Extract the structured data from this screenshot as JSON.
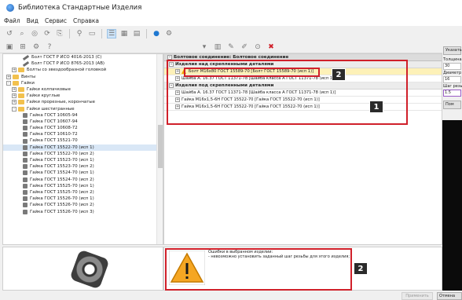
{
  "window": {
    "title": "Библиотека Стандартные Изделия"
  },
  "menu": [
    "Файл",
    "Вид",
    "Сервис",
    "Справка"
  ],
  "toolbar1_icons": [
    "reset-icon",
    "search-icon",
    "zoom-icon",
    "refresh-icon",
    "copy-icon",
    "filter-icon",
    "folder-icon",
    "view-list-icon",
    "view-grid-icon",
    "view-table-icon",
    "help-icon",
    "settings-icon"
  ],
  "toolbar2_icons": [
    "library-icon",
    "add-icon",
    "settings-icon",
    "help-icon"
  ],
  "main_toolbar_icons": [
    "save-icon",
    "table-icon",
    "settings-icon",
    "settings2-icon",
    "target-icon",
    "delete-icon"
  ],
  "tree": [
    {
      "label": "Болт ГОСТ Р ИСО 4016-2013 (С)",
      "type": "bolt",
      "indent": 3
    },
    {
      "label": "Болт ГОСТ Р ИСО 8765-2013 (АВ)",
      "type": "bolt",
      "indent": 3
    },
    {
      "label": "Болты со звездообразной головкой",
      "type": "folder",
      "indent": 1,
      "exp": "+"
    },
    {
      "label": "Винты",
      "type": "folder",
      "indent": 0,
      "exp": "+"
    },
    {
      "label": "Гайки",
      "type": "folder",
      "indent": 0,
      "exp": "-"
    },
    {
      "label": "Гайки колпачковые",
      "type": "folder",
      "indent": 1,
      "exp": "+"
    },
    {
      "label": "Гайки круглые",
      "type": "folder",
      "indent": 1,
      "exp": "+"
    },
    {
      "label": "Гайки прорезные, корончатые",
      "type": "folder",
      "indent": 1,
      "exp": "+"
    },
    {
      "label": "Гайки шестигранные",
      "type": "folder",
      "indent": 1,
      "exp": "-"
    },
    {
      "label": "Гайка ГОСТ 10605-94",
      "type": "nut",
      "indent": 3
    },
    {
      "label": "Гайка ГОСТ 10607-94",
      "type": "nut",
      "indent": 3
    },
    {
      "label": "Гайка ГОСТ 10608-72",
      "type": "nut",
      "indent": 3
    },
    {
      "label": "Гайка ГОСТ 10610-72",
      "type": "nut",
      "indent": 3
    },
    {
      "label": "Гайка ГОСТ 15521-70",
      "type": "nut",
      "indent": 3
    },
    {
      "label": "Гайка ГОСТ 15522-70 (исп 1)",
      "type": "nut",
      "indent": 3,
      "selected": true
    },
    {
      "label": "Гайка ГОСТ 15522-70 (исп 2)",
      "type": "nut",
      "indent": 3
    },
    {
      "label": "Гайка ГОСТ 15523-70 (исп 1)",
      "type": "nut",
      "indent": 3
    },
    {
      "label": "Гайка ГОСТ 15523-70 (исп 2)",
      "type": "nut",
      "indent": 3
    },
    {
      "label": "Гайка ГОСТ 15524-70 (исп 1)",
      "type": "nut",
      "indent": 3
    },
    {
      "label": "Гайка ГОСТ 15524-70 (исп 2)",
      "type": "nut",
      "indent": 3
    },
    {
      "label": "Гайка ГОСТ 15525-70 (исп 1)",
      "type": "nut",
      "indent": 3
    },
    {
      "label": "Гайка ГОСТ 15525-70 (исп 2)",
      "type": "nut",
      "indent": 3
    },
    {
      "label": "Гайка ГОСТ 15526-70 (исп 1)",
      "type": "nut",
      "indent": 3
    },
    {
      "label": "Гайка ГОСТ 15526-70 (исп 2)",
      "type": "nut",
      "indent": 3
    },
    {
      "label": "Гайка ГОСТ 15526-70 (исп 3)",
      "type": "nut",
      "indent": 3
    }
  ],
  "main": {
    "group_title": "Болтовое соединение: Болтовое соединение",
    "section_above": "Изделия над скрепленными деталями",
    "items_above": [
      {
        "text": "Болт М16х80 ГОСТ 15589-70     [Болт ГОСТ 15589-70 (исп 1)]",
        "warning": true
      },
      {
        "text": "Шайба А. 16.37 ГОСТ 11371-78     [Шайба класса А ГОСТ 11371-78 (исп 1)]",
        "warning": false
      }
    ],
    "section_below": "Изделия под скрепленными деталями",
    "items_below": [
      {
        "text": "Шайба А. 16.37 ГОСТ 11371-78     [Шайба класса А ГОСТ 11371-78 (исп 1)]"
      },
      {
        "text": "Гайка М16х1,5-6Н ГОСТ 15522-70     [Гайка ГОСТ 15522-70 (исп 1)]"
      },
      {
        "text": "Гайка М16х1,5-6Н ГОСТ 15522-70     [Гайка ГОСТ 15522-70 (исп 1)]"
      }
    ]
  },
  "right_panel": {
    "header": "Указать",
    "fields": [
      {
        "label": "Толщина",
        "value": "30"
      },
      {
        "label": "Диаметр",
        "value": "16"
      },
      {
        "label": "Шаг резьб",
        "value": "1.5"
      }
    ],
    "button": "Пом"
  },
  "errors": {
    "line1": "Ошибки в выбранном изделии:",
    "line2": "- невозможно установить заданный шаг резьбы для этого изделия;"
  },
  "badges": [
    "1",
    "2",
    "2"
  ],
  "buttons": {
    "apply": "Применить",
    "cancel": "Отмена"
  },
  "colors": {
    "highlight_box": "#d0202a",
    "warning": "#f0a500",
    "selection": "#d9e7f6"
  }
}
